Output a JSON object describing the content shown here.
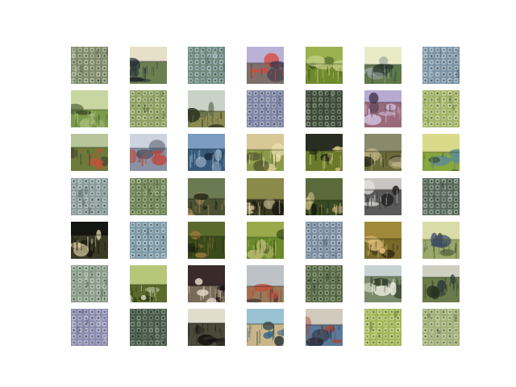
{
  "grid": {
    "rows": 7,
    "cols": 7
  },
  "tiles": [
    {
      "style": "pattern",
      "base": "#7e8a6a",
      "accent": "#c9d3b8",
      "dark": "#3f4a36"
    },
    {
      "style": "scene",
      "sky": "#e6e0c8",
      "ground": "#6c7f4f",
      "accent": "#2f3a45",
      "dark": "#1f262b"
    },
    {
      "style": "pattern",
      "base": "#6f8a7c",
      "accent": "#b8cbd2",
      "dark": "#394a44"
    },
    {
      "style": "scene",
      "sky": "#b9b2d6",
      "ground": "#7d6f6a",
      "accent": "#d9473a",
      "dark": "#3b3a4c"
    },
    {
      "style": "scene",
      "sky": "#9bb24e",
      "ground": "#6f8a2c",
      "accent": "#c8d08a",
      "dark": "#3f4f22"
    },
    {
      "style": "scene",
      "sky": "#e8ebc6",
      "ground": "#5f7a4a",
      "accent": "#9aa6a0",
      "dark": "#2b3a2e"
    },
    {
      "style": "pattern",
      "base": "#7d94a6",
      "accent": "#c6d6de",
      "dark": "#3c4c58"
    },
    {
      "style": "scene",
      "sky": "#c8d6a2",
      "ground": "#7a9a4a",
      "accent": "#a8c07a",
      "dark": "#3e4e28"
    },
    {
      "style": "pattern",
      "base": "#8ea064",
      "accent": "#cad6a8",
      "dark": "#45532f"
    },
    {
      "style": "scene",
      "sky": "#c9d2c6",
      "ground": "#8a8a52",
      "accent": "#5a6a4a",
      "dark": "#2f3422"
    },
    {
      "style": "pattern",
      "base": "#7f86a4",
      "accent": "#c0c6d8",
      "dark": "#3e4458"
    },
    {
      "style": "pattern",
      "base": "#3f4a3a",
      "accent": "#8ea08a",
      "dark": "#1f2620"
    },
    {
      "style": "scene",
      "sky": "#b6aad0",
      "ground": "#9a6a7a",
      "accent": "#d2c4e0",
      "dark": "#4a3a52"
    },
    {
      "style": "pattern",
      "base": "#a4b46a",
      "accent": "#d6dfae",
      "dark": "#55623a"
    },
    {
      "style": "scene",
      "sky": "#b8c49a",
      "ground": "#6c7a3a",
      "accent": "#c6503a",
      "dark": "#33402a"
    },
    {
      "style": "scene",
      "sky": "#cdd4e0",
      "ground": "#8a92a6",
      "accent": "#c84030",
      "dark": "#3e4452"
    },
    {
      "style": "scene",
      "sky": "#7a9cc0",
      "ground": "#3a5a7a",
      "accent": "#a8c0d6",
      "dark": "#16263a"
    },
    {
      "style": "scene",
      "sky": "#d8c898",
      "ground": "#8a9a4a",
      "accent": "#f0e2b0",
      "dark": "#4a4a26"
    },
    {
      "style": "scene",
      "sky": "#2a2e22",
      "ground": "#6a7a2a",
      "accent": "#e0d48a",
      "dark": "#121510"
    },
    {
      "style": "scene",
      "sky": "#8a8a6a",
      "ground": "#6a6a3a",
      "accent": "#c4b88a",
      "dark": "#2c2c1c"
    },
    {
      "style": "scene",
      "sky": "#d8da8a",
      "ground": "#8aa83a",
      "accent": "#5a8a9a",
      "dark": "#3a4a1a"
    },
    {
      "style": "pattern",
      "base": "#8a9c9a",
      "accent": "#c6d2d2",
      "dark": "#434e4c"
    },
    {
      "style": "pattern",
      "base": "#6f8458",
      "accent": "#b8c89a",
      "dark": "#36422a"
    },
    {
      "style": "scene",
      "sky": "#6a7a52",
      "ground": "#4a5232",
      "accent": "#b08a5a",
      "dark": "#1f2414"
    },
    {
      "style": "scene",
      "sky": "#8a8a4a",
      "ground": "#3a3a22",
      "accent": "#e0d2a0",
      "dark": "#16160e"
    },
    {
      "style": "scene",
      "sky": "#5a6a3a",
      "ground": "#3a4a22",
      "accent": "#d2c08a",
      "dark": "#141a0c"
    },
    {
      "style": "scene",
      "sky": "#c8c6c0",
      "ground": "#5a5a5a",
      "accent": "#e8e6e0",
      "dark": "#222222"
    },
    {
      "style": "pattern",
      "base": "#5a6a5a",
      "accent": "#a8b8b0",
      "dark": "#2a342c"
    },
    {
      "style": "scene",
      "sky": "#141612",
      "ground": "#3a3a26",
      "accent": "#e2d4a8",
      "dark": "#060706"
    },
    {
      "style": "pattern",
      "base": "#7e9aa6",
      "accent": "#c4d6de",
      "dark": "#3e4e56"
    },
    {
      "style": "scene",
      "sky": "#5a6a2e",
      "ground": "#3a4a1a",
      "accent": "#a07a3a",
      "dark": "#182010"
    },
    {
      "style": "scene",
      "sky": "#9aaa4a",
      "ground": "#6a8a2a",
      "accent": "#c6c07a",
      "dark": "#344418"
    },
    {
      "style": "pattern",
      "base": "#7a8ea0",
      "accent": "#c2d0da",
      "dark": "#3a4856"
    },
    {
      "style": "scene",
      "sky": "#a08a3a",
      "ground": "#7a6a2a",
      "accent": "#e2c27a",
      "dark": "#352c12"
    },
    {
      "style": "scene",
      "sky": "#dadca8",
      "ground": "#9aa86a",
      "accent": "#3a4a6a",
      "dark": "#44502c"
    },
    {
      "style": "pattern",
      "base": "#8a9c8a",
      "accent": "#cad6c8",
      "dark": "#445044"
    },
    {
      "style": "scene",
      "sky": "#b8c67a",
      "ground": "#5a6a2a",
      "accent": "#e0e2c6",
      "dark": "#24300e"
    },
    {
      "style": "scene",
      "sky": "#3a2a2a",
      "ground": "#7a6a5a",
      "accent": "#e6dcc8",
      "dark": "#120c0c"
    },
    {
      "style": "scene",
      "sky": "#bcc2c6",
      "ground": "#9a7a5a",
      "accent": "#c2503a",
      "dark": "#3a3230"
    },
    {
      "style": "pattern",
      "base": "#5a6a4a",
      "accent": "#9ab08a",
      "dark": "#263020"
    },
    {
      "style": "scene",
      "sky": "#c6d2d2",
      "ground": "#7a8a6a",
      "accent": "#eef0e2",
      "dark": "#34402c"
    },
    {
      "style": "scene",
      "sky": "#cfd0c2",
      "ground": "#6a7a4a",
      "accent": "#2a3a3a",
      "dark": "#263020"
    },
    {
      "style": "pattern",
      "base": "#8c8cae",
      "accent": "#c8cade",
      "dark": "#44465a"
    },
    {
      "style": "pattern",
      "base": "#4a5a4a",
      "accent": "#8ea08e",
      "dark": "#1e2620"
    },
    {
      "style": "scene",
      "sky": "#e2dccc",
      "ground": "#4a4a3a",
      "accent": "#2a2a22",
      "dark": "#121210"
    },
    {
      "style": "scene",
      "sky": "#9ac2d2",
      "ground": "#c8b68a",
      "accent": "#3a6a8a",
      "dark": "#2a3a40"
    },
    {
      "style": "scene",
      "sky": "#d2cabc",
      "ground": "#5a7a9a",
      "accent": "#a04a3a",
      "dark": "#2a3040"
    },
    {
      "style": "pattern",
      "base": "#a2b65a",
      "accent": "#d8e2a2",
      "dark": "#4e5e2a"
    },
    {
      "style": "pattern",
      "base": "#a2b07a",
      "accent": "#d2dcb2",
      "dark": "#50583c"
    }
  ]
}
